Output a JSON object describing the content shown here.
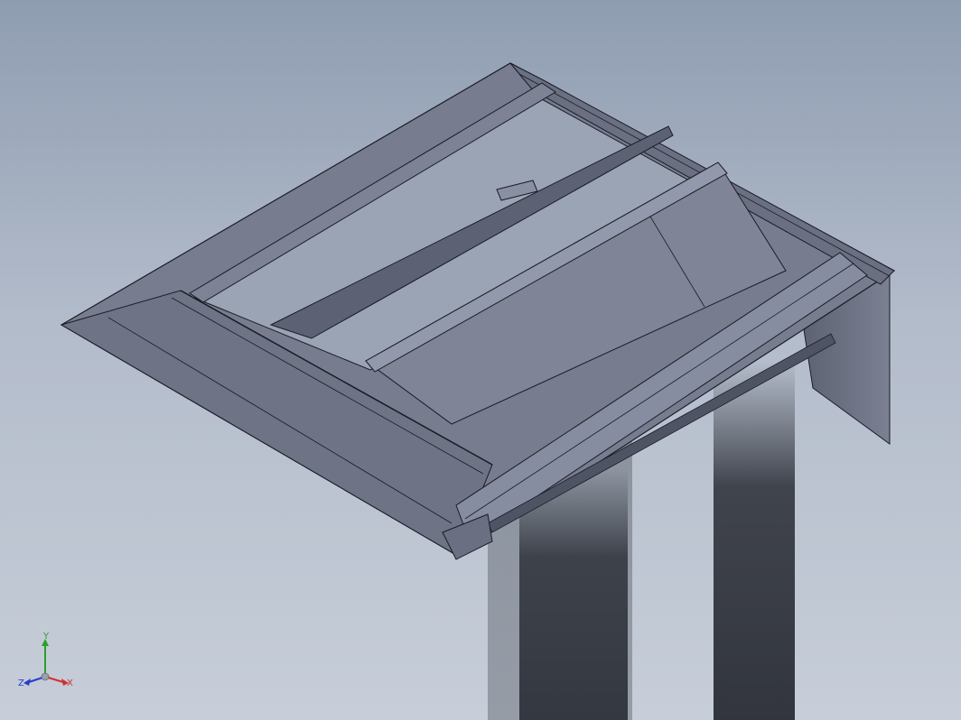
{
  "viewport": {
    "background_top": "#8f9db1",
    "background_bottom": "#c7ced9"
  },
  "model": {
    "name": "",
    "part_color": "#6f7487",
    "part_color_light": "#8a90a3",
    "edge_color": "#1a1c24"
  },
  "triad": {
    "x_label": "X",
    "y_label": "Y",
    "z_label": "Z",
    "x_color": "#d03030",
    "y_color": "#2aa02a",
    "z_color": "#2a3cc8"
  }
}
